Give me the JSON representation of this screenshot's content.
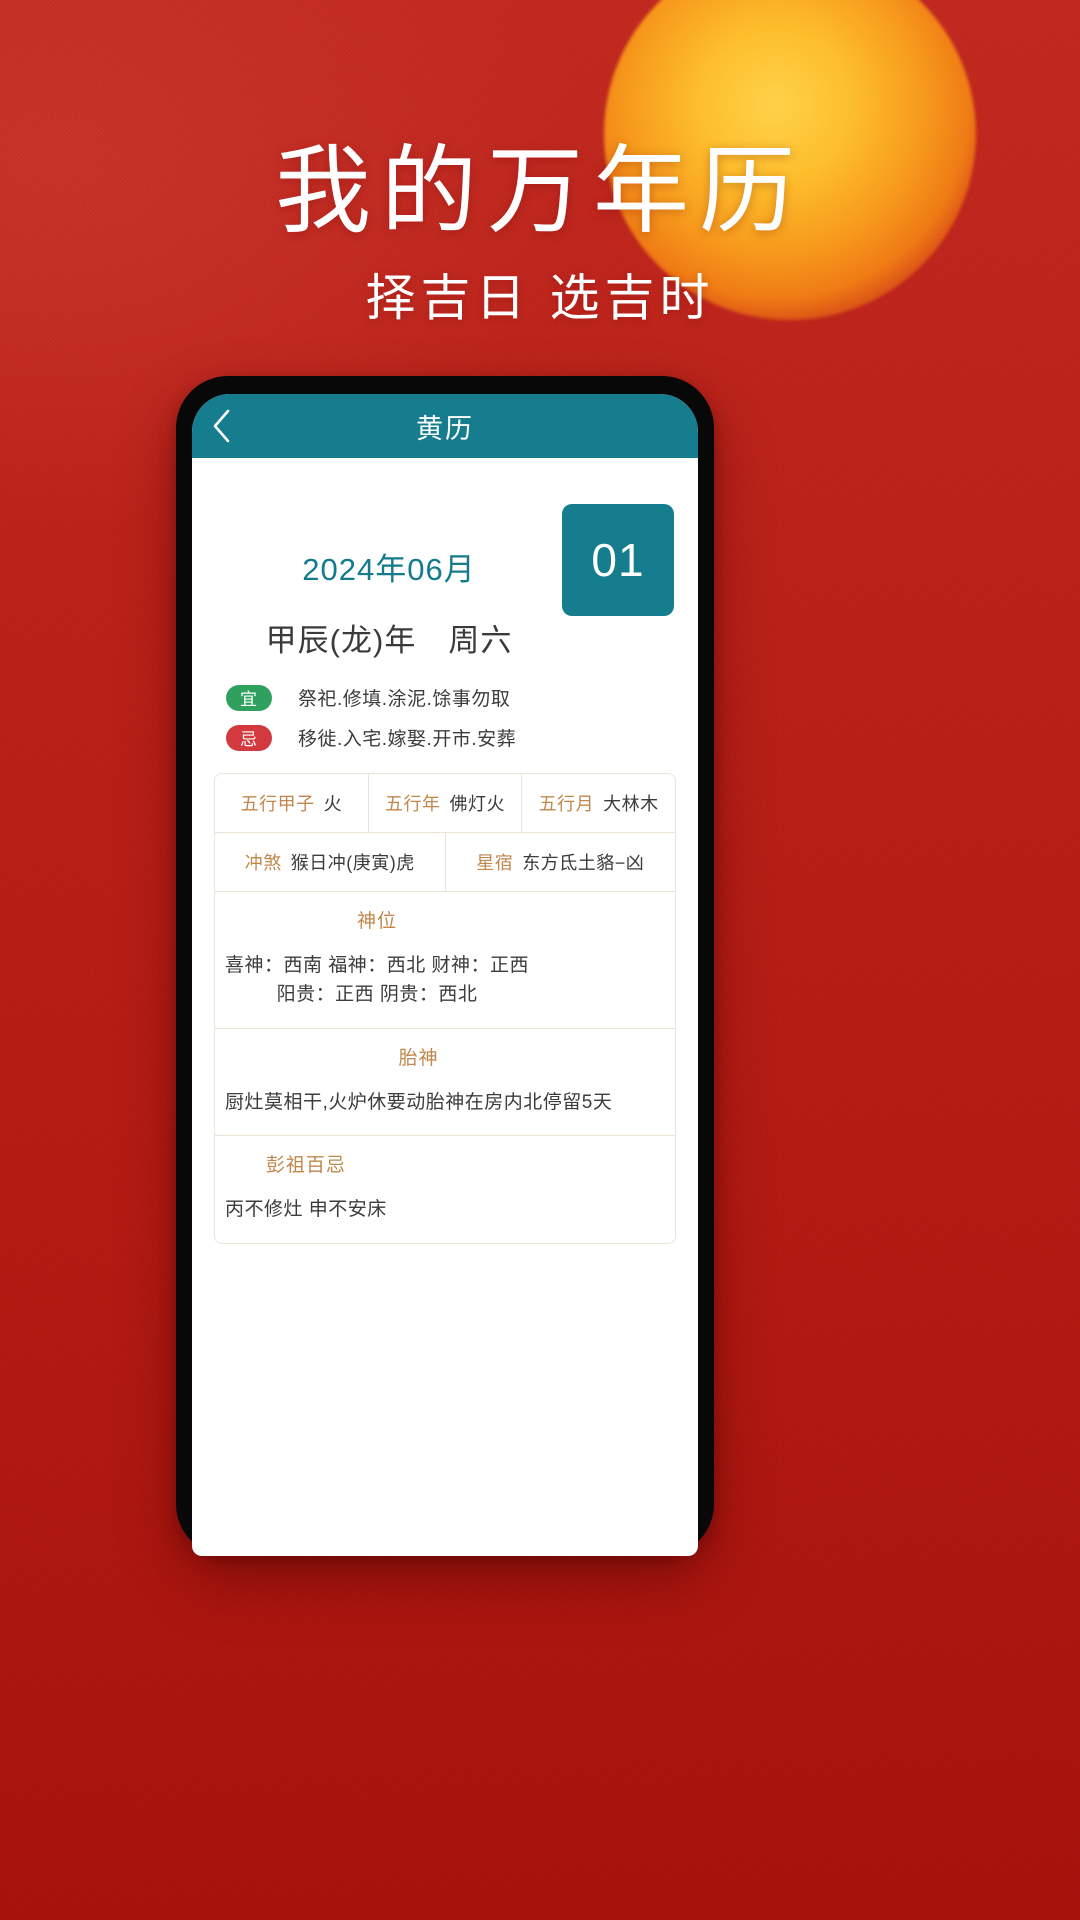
{
  "poster": {
    "title": "我的万年历",
    "subtitle": "择吉日 选吉时",
    "brand_red": "#b81f18",
    "sun_color": "#f79a1c"
  },
  "app": {
    "accent_teal": "#157d8e",
    "appbar": {
      "back_icon": "chevron-left-icon",
      "title": "黄历"
    },
    "date": {
      "year_month": "2024年06月",
      "ganzhi_week": "甲辰(龙)年　周六",
      "day": "01"
    },
    "yi_ji": [
      {
        "badge": "宜",
        "badge_color": "#2fa05e",
        "text": "祭祀.修填.涂泥.馀事勿取"
      },
      {
        "badge": "忌",
        "badge_color": "#d23a3f",
        "text": "移徙.入宅.嫁娶.开市.安葬"
      }
    ],
    "info_rows": [
      [
        {
          "label": "五行甲子",
          "value": "火"
        },
        {
          "label": "五行年",
          "value": "佛灯火"
        },
        {
          "label": "五行月",
          "value": "大林木"
        }
      ],
      [
        {
          "label": "冲煞",
          "value": "猴日冲(庚寅)虎"
        },
        {
          "label": "星宿",
          "value": "东方氐土貉−凶"
        }
      ]
    ],
    "info_blocks": [
      {
        "title": "神位",
        "line1": "喜神：西南 福神：西北 财神：正西",
        "line2": "阳贵：正西 阴贵：西北"
      },
      {
        "title": "胎神",
        "line1": "厨灶莫相干,火炉休要动胎神在房内北停留5天",
        "line2": ""
      },
      {
        "title": "彭祖百忌",
        "line1": "丙不修灶 申不安床",
        "line2": ""
      }
    ]
  }
}
